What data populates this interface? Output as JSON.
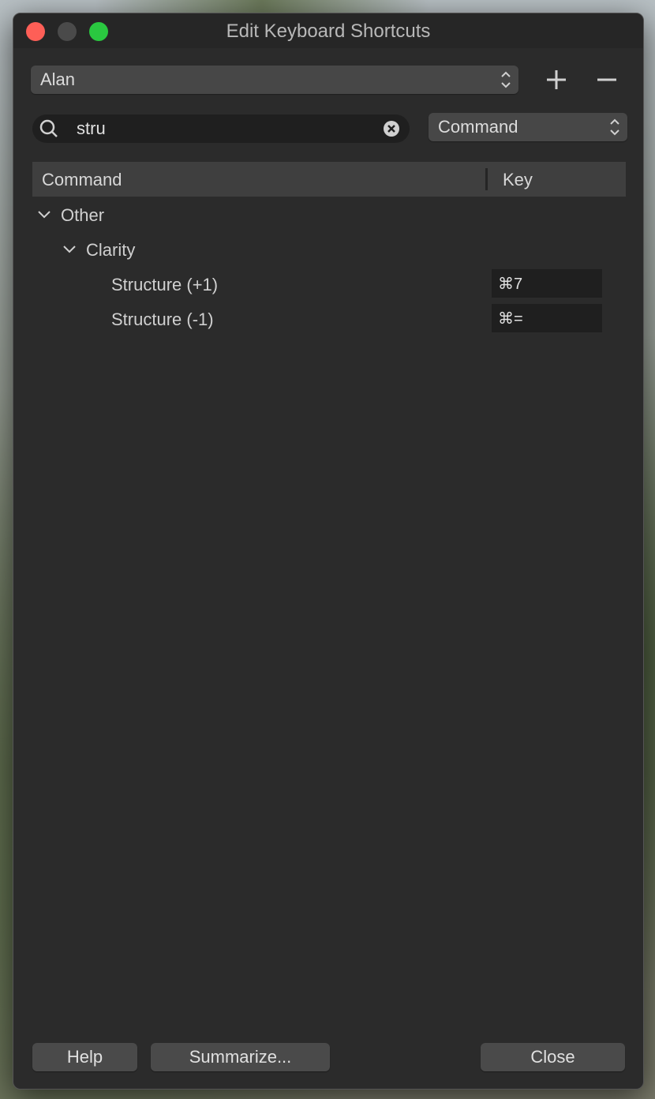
{
  "window": {
    "title": "Edit Keyboard Shortcuts"
  },
  "titlebar": {
    "buttons": [
      "close",
      "minimize",
      "maximize"
    ],
    "colors": {
      "close": "#fe5f57",
      "minimize": "#4a4a4a",
      "maximize": "#2ac840"
    }
  },
  "shortcut_set": {
    "selected": "Alan",
    "add_icon": "plus-icon",
    "remove_icon": "minus-icon"
  },
  "search": {
    "value": "stru",
    "icon": "magnifier-icon",
    "clear_icon": "clear-x-circle-icon"
  },
  "search_field": {
    "selected": "Command"
  },
  "table": {
    "columns": [
      "Command",
      "Key"
    ],
    "tree": {
      "group_label": "Other",
      "subgroup_label": "Clarity",
      "items": [
        {
          "command": "Structure (+1)",
          "key": "⌘7"
        },
        {
          "command": "Structure (-1)",
          "key": "⌘="
        }
      ]
    }
  },
  "footer": {
    "help_label": "Help",
    "summarize_label": "Summarize...",
    "close_label": "Close"
  }
}
